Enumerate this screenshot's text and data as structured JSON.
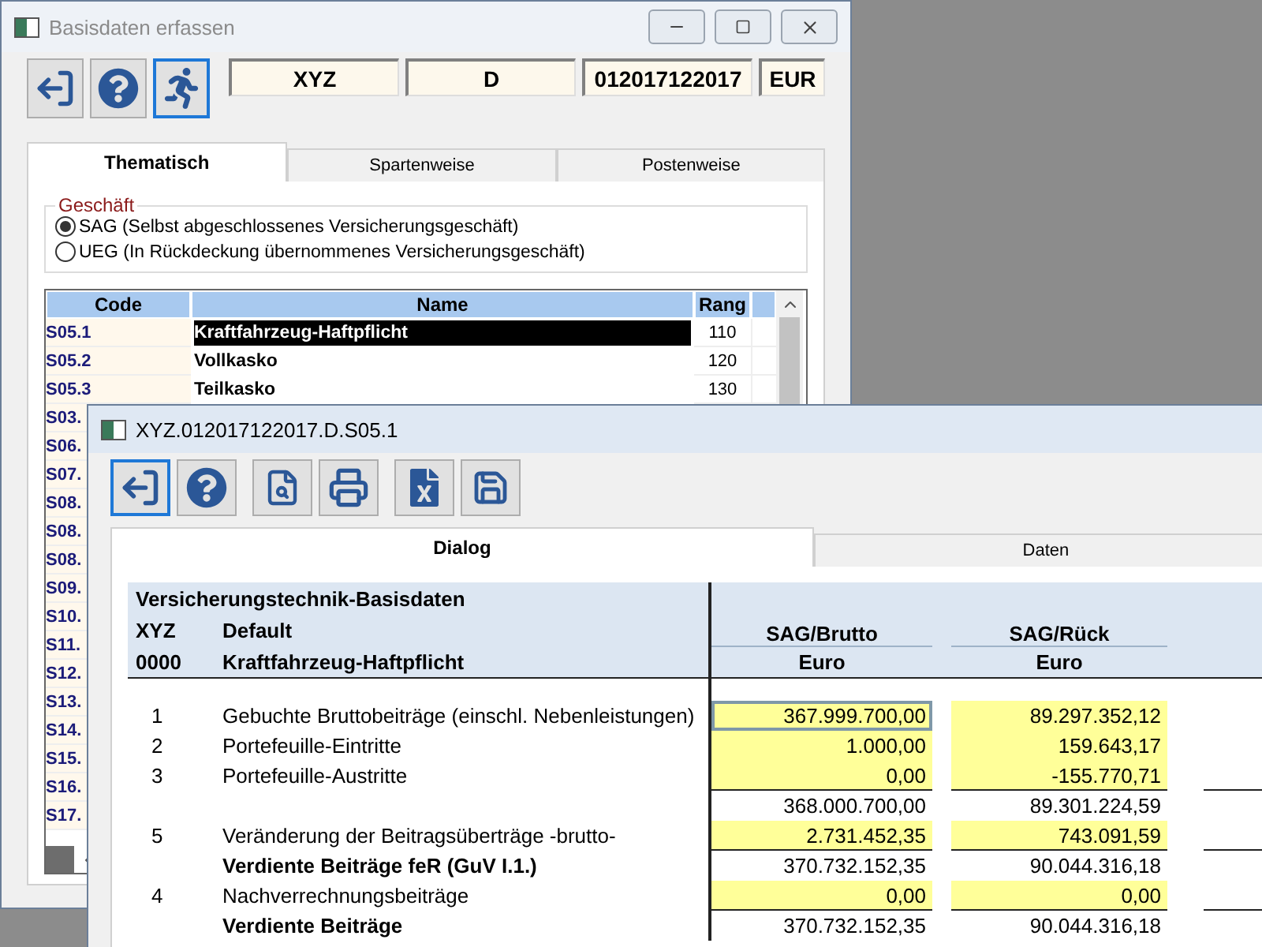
{
  "main_window": {
    "title": "Basisdaten erfassen",
    "toolbar": [
      {
        "kind": "exit",
        "selected": false
      },
      {
        "kind": "help",
        "selected": false
      },
      {
        "kind": "run",
        "selected": true
      }
    ],
    "header_fields": [
      "XYZ",
      "D",
      "012017122017",
      "EUR"
    ],
    "tabs": [
      {
        "label": "Thematisch",
        "selected": true
      },
      {
        "label": "Spartenweise",
        "selected": false
      },
      {
        "label": "Postenweise",
        "selected": false
      }
    ],
    "group": {
      "title": "Geschäft",
      "options": [
        {
          "label": "SAG (Selbst abgeschlossenes Versicherungsgeschäft)",
          "selected": true
        },
        {
          "label": "UEG (In Rückdeckung übernommenes Versicherungsgeschäft)",
          "selected": false
        }
      ]
    },
    "table": {
      "columns": [
        "Code",
        "Name",
        "Rang"
      ],
      "rows": [
        {
          "code": "S05.1",
          "name": "Kraftfahrzeug-Haftpflicht",
          "rang": "110",
          "selected": true
        },
        {
          "code": "S05.2",
          "name": "Vollkasko",
          "rang": "120",
          "selected": false
        },
        {
          "code": "S05.3",
          "name": "Teilkasko",
          "rang": "130",
          "selected": false
        },
        {
          "code": "S03."
        },
        {
          "code": "S06."
        },
        {
          "code": "S07."
        },
        {
          "code": "S08."
        },
        {
          "code": "S08."
        },
        {
          "code": "S08."
        },
        {
          "code": "S09."
        },
        {
          "code": "S10."
        },
        {
          "code": "S11."
        },
        {
          "code": "S12."
        },
        {
          "code": "S13."
        },
        {
          "code": "S14."
        },
        {
          "code": "S15."
        },
        {
          "code": "S16."
        },
        {
          "code": "S17."
        }
      ]
    }
  },
  "detail_window": {
    "title": "XYZ.012017122017.D.S05.1",
    "toolbar": [
      {
        "kind": "exit",
        "selected": true
      },
      {
        "kind": "help",
        "selected": false
      },
      {
        "kind": "preview",
        "selected": false
      },
      {
        "kind": "print",
        "selected": false
      },
      {
        "kind": "excel",
        "selected": false
      },
      {
        "kind": "save",
        "selected": false
      }
    ],
    "tabs": [
      {
        "label": "Dialog",
        "selected": true
      },
      {
        "label": "Daten",
        "selected": false
      }
    ],
    "sheet": {
      "title": "Versicherungstechnik-Basisdaten",
      "info": [
        {
          "code": "XYZ",
          "text": "Default"
        },
        {
          "code": "0000",
          "text": "Kraftfahrzeug-Haftpflicht"
        }
      ],
      "columns": [
        {
          "title": "SAG/Brutto",
          "unit": "Euro"
        },
        {
          "title": "SAG/Rück",
          "unit": "Euro"
        }
      ],
      "rows": [
        {
          "number": "1",
          "label": "Gebuchte Bruttobeiträge (einschl. Nebenleistungen)",
          "bold": false,
          "underlined": false,
          "values": [
            {
              "text": "367.999.700,00",
              "kind": "input",
              "selected": true
            },
            {
              "text": "89.297.352,12",
              "kind": "input",
              "selected": false
            }
          ]
        },
        {
          "number": "2",
          "label": "Portefeuille-Eintritte",
          "bold": false,
          "underlined": false,
          "values": [
            {
              "text": "1.000,00",
              "kind": "input",
              "selected": false
            },
            {
              "text": "159.643,17",
              "kind": "input",
              "selected": false
            }
          ]
        },
        {
          "number": "3",
          "label": "Portefeuille-Austritte",
          "bold": false,
          "underlined": true,
          "values": [
            {
              "text": "0,00",
              "kind": "input",
              "selected": false
            },
            {
              "text": "-155.770,71",
              "kind": "input",
              "selected": false
            }
          ]
        },
        {
          "bold": false,
          "underlined": false,
          "values": [
            {
              "text": "368.000.700,00",
              "kind": "calc",
              "selected": false
            },
            {
              "text": "89.301.224,59",
              "kind": "calc",
              "selected": false
            }
          ]
        },
        {
          "number": "5",
          "label": "Veränderung der Beitragsüberträge -brutto-",
          "bold": false,
          "underlined": true,
          "values": [
            {
              "text": "2.731.452,35",
              "kind": "input",
              "selected": false
            },
            {
              "text": "743.091,59",
              "kind": "input",
              "selected": false
            }
          ]
        },
        {
          "label": "Verdiente Beiträge feR (GuV I.1.)",
          "bold": true,
          "underlined": false,
          "values": [
            {
              "text": "370.732.152,35",
              "kind": "calc",
              "selected": false
            },
            {
              "text": "90.044.316,18",
              "kind": "calc",
              "selected": false
            }
          ]
        },
        {
          "number": "4",
          "label": "Nachverrechnungsbeiträge",
          "bold": false,
          "underlined": true,
          "values": [
            {
              "text": "0,00",
              "kind": "input",
              "selected": false
            },
            {
              "text": "0,00",
              "kind": "input",
              "selected": false
            }
          ]
        },
        {
          "label": "Verdiente Beiträge",
          "bold": true,
          "underlined": false,
          "values": [
            {
              "text": "370.732.152,35",
              "kind": "calc",
              "selected": false
            },
            {
              "text": "90.044.316,18",
              "kind": "calc",
              "selected": false
            }
          ]
        }
      ]
    }
  }
}
